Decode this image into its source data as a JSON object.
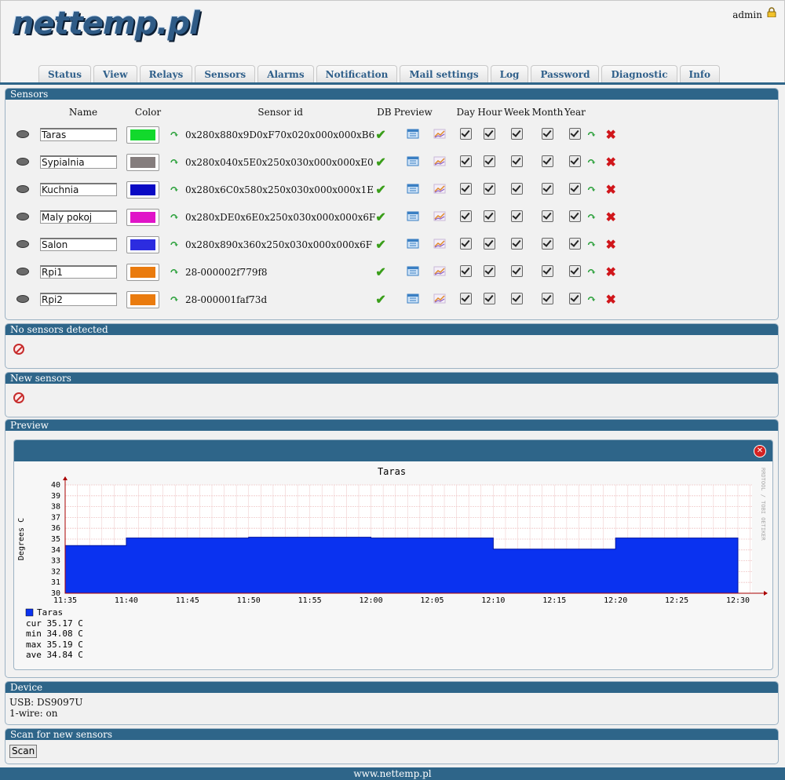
{
  "logo": "nettemp.pl",
  "user": "admin",
  "tabs": [
    "Status",
    "View",
    "Relays",
    "Sensors",
    "Alarms",
    "Notification",
    "Mail settings",
    "Log",
    "Password",
    "Diagnostic",
    "Info"
  ],
  "sensors_panel": {
    "title": "Sensors",
    "headers": {
      "name": "Name",
      "color": "Color",
      "sensor_id": "Sensor id",
      "db": "DB",
      "preview": "Preview",
      "day": "Day",
      "hour": "Hour",
      "week": "Week",
      "month": "Month",
      "year": "Year"
    },
    "rows": [
      {
        "name": "Taras",
        "color": "#12d92c",
        "id": "0x280x880x9D0xF70x020x000x000xB6"
      },
      {
        "name": "Sypialnia",
        "color": "#857d7d",
        "id": "0x280x040x5E0x250x030x000x000xE0"
      },
      {
        "name": "Kuchnia",
        "color": "#0a0ac4",
        "id": "0x280x6C0x580x250x030x000x000x1E"
      },
      {
        "name": "Maly pokoj",
        "color": "#e014c8",
        "id": "0x280xDE0x6E0x250x030x000x000x6F"
      },
      {
        "name": "Salon",
        "color": "#2c2ce0",
        "id": "0x280x890x360x250x030x000x000x6F"
      },
      {
        "name": "Rpi1",
        "color": "#ea7b0e",
        "id": "28-000002f779f8"
      },
      {
        "name": "Rpi2",
        "color": "#ea7b0e",
        "id": "28-000001faf73d"
      }
    ]
  },
  "no_sensors_panel": {
    "title": "No sensors detected"
  },
  "new_sensors_panel": {
    "title": "New sensors"
  },
  "preview_panel": {
    "title": "Preview"
  },
  "chart_data": {
    "type": "area",
    "title": "Taras",
    "ylabel": "Degrees C",
    "xlabel": "",
    "side_text": "RRDTOOL / TOBI OETIKER",
    "x_ticks": [
      "11:35",
      "11:40",
      "11:45",
      "11:50",
      "11:55",
      "12:00",
      "12:05",
      "12:10",
      "12:15",
      "12:20",
      "12:25",
      "12:30"
    ],
    "y_ticks": [
      30,
      31,
      32,
      33,
      34,
      35,
      36,
      37,
      38,
      39,
      40
    ],
    "ylim": [
      30,
      40
    ],
    "series": [
      {
        "name": "Taras",
        "color": "#0a32f0",
        "x": [
          "11:35",
          "11:40",
          "11:45",
          "11:50",
          "11:55",
          "12:00",
          "12:05",
          "12:10",
          "12:15",
          "12:20",
          "12:25",
          "12:30"
        ],
        "values": [
          34.4,
          35.1,
          35.1,
          35.17,
          35.17,
          35.1,
          35.1,
          34.08,
          34.08,
          35.1,
          35.1,
          35.1
        ]
      }
    ],
    "legend": {
      "name": "Taras",
      "cur": "cur 35.17 C",
      "min": "min 34.08 C",
      "max": "max 35.19 C",
      "ave": "ave 34.84 C"
    }
  },
  "device_panel": {
    "title": "Device",
    "usb": "USB: DS9097U",
    "onewire": "1-wire: on"
  },
  "scan_panel": {
    "title": "Scan for new sensors",
    "button": "Scan"
  },
  "footer": "www.nettemp.pl"
}
